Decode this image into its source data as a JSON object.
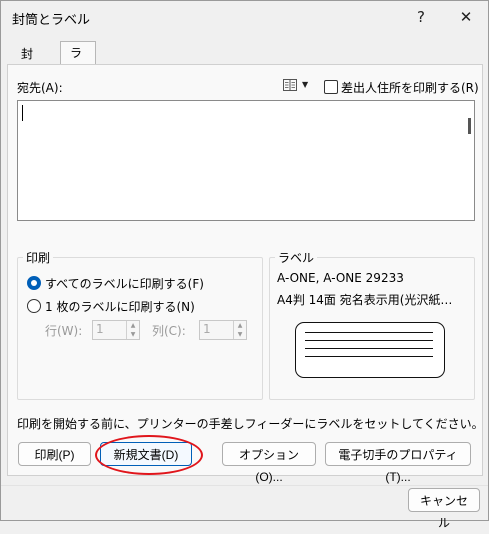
{
  "window": {
    "title": "封筒とラベル",
    "help_glyph": "?",
    "close_glyph": "✕"
  },
  "tabs": [
    {
      "label": "封筒"
    },
    {
      "label": "ラベル(L)"
    }
  ],
  "address": {
    "label": "宛先(A):",
    "value": "",
    "book_icon": "address-book-icon",
    "checkbox_label": "差出人住所を印刷する(R)",
    "checked": false
  },
  "print_group": {
    "title": "印刷",
    "option_all": "すべてのラベルに印刷する(F)",
    "option_single": "1 枚のラベルに印刷する(N)",
    "selected": "all",
    "row_label": "行(W):",
    "row_value": "1",
    "col_label": "列(C):",
    "col_value": "1"
  },
  "label_group": {
    "title": "ラベル",
    "line1": "A-ONE, A-ONE 29233",
    "line2": "A4判 14面 宛名表示用(光沢紙…"
  },
  "hint": "印刷を開始する前に、プリンターの手差しフィーダーにラベルをセットしてください。",
  "buttons": {
    "print": "印刷(P)",
    "new_document": "新規文書(D)",
    "options": "オプション(O)...",
    "postage_properties": "電子切手のプロパティ(T)...",
    "cancel": "キャンセル"
  },
  "colors": {
    "accent": "#005fb8",
    "highlight_oval": "#e0151b"
  }
}
